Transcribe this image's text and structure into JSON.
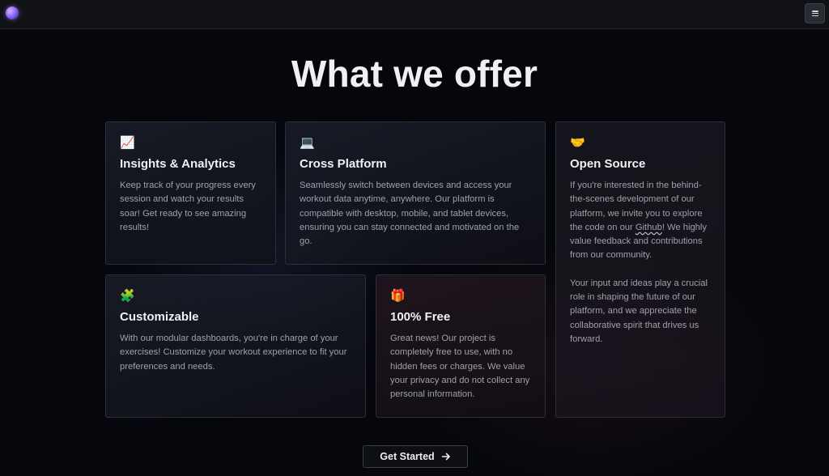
{
  "header": {
    "logo_name": "gradient-orb-logo",
    "menu_icon": "hamburger-menu-icon"
  },
  "page": {
    "title": "What we offer"
  },
  "features": [
    {
      "icon": "📈",
      "icon_name": "chart-increasing-icon",
      "title": "Insights & Analytics",
      "body": "Keep track of your progress every session and watch your results soar! Get ready to see amazing results!"
    },
    {
      "icon": "💻",
      "icon_name": "laptop-icon",
      "title": "Cross Platform",
      "body": "Seamlessly switch between devices and access your workout data anytime, anywhere. Our platform is compatible with desktop, mobile, and tablet devices, ensuring you can stay connected and motivated on the go."
    },
    {
      "icon": "🤝",
      "icon_name": "handshake-icon",
      "title": "Open Source",
      "body_before_link": "If you're interested in the behind-the-scenes development of our platform, we invite you to explore the code on our ",
      "link_text": "Github",
      "body_after_link": "! We highly value feedback and contributions from our community.",
      "body_2": "Your input and ideas play a crucial role in shaping the future of our platform, and we appreciate the collaborative spirit that drives us forward."
    },
    {
      "icon": "🧩",
      "icon_name": "puzzle-piece-icon",
      "title": "Customizable",
      "body": "With our modular dashboards, you're in charge of your exercises! Customize your workout experience to fit your preferences and needs."
    },
    {
      "icon": "🎁",
      "icon_name": "gift-icon",
      "title": "100% Free",
      "body": "Great news! Our project is completely free to use, with no hidden fees or charges. We value your privacy and do not collect any personal information."
    }
  ],
  "cta": {
    "label": "Get Started",
    "icon_name": "arrow-right-icon"
  },
  "colors": {
    "background": "#06070c",
    "topbar": "#111216",
    "card_border": "#2c2f38",
    "text_muted": "#9ea1aa",
    "text_heading": "#f0f1f4"
  }
}
